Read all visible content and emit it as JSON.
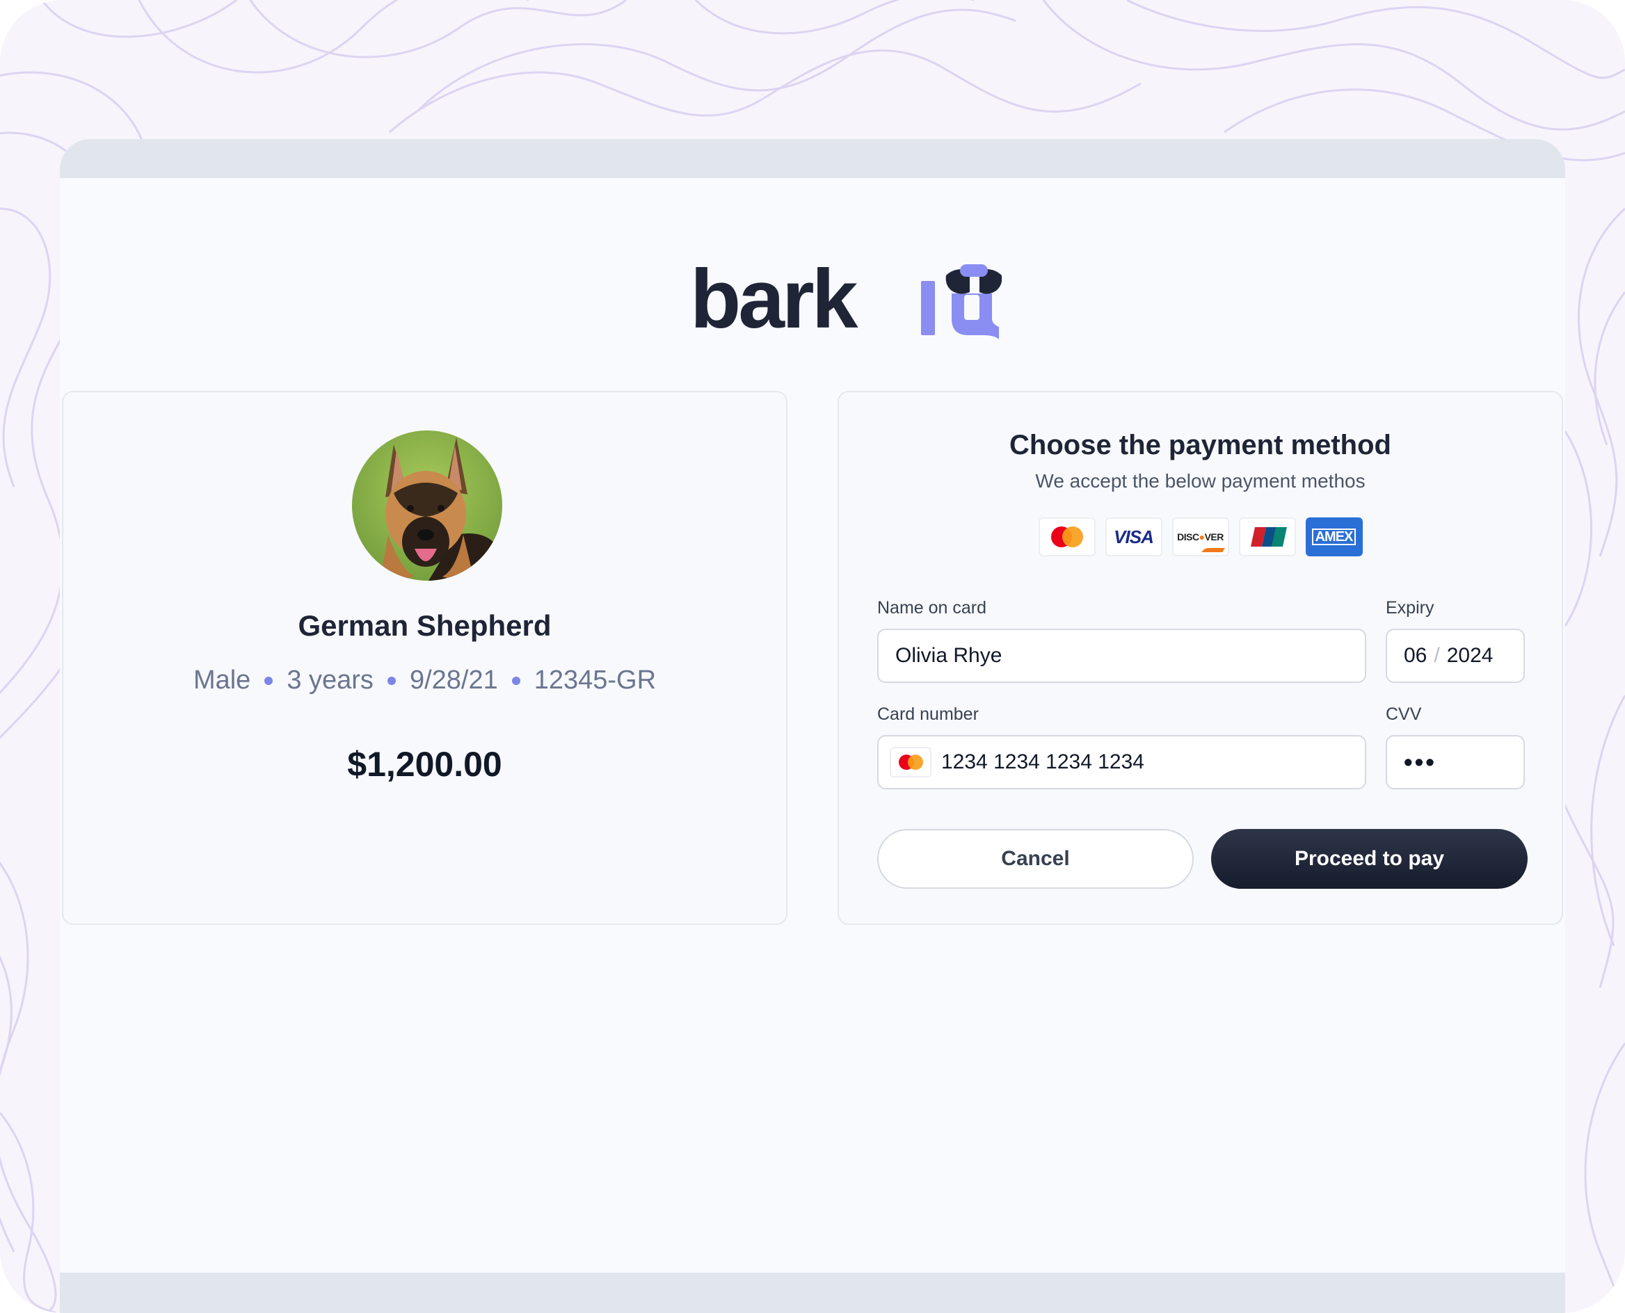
{
  "brand": {
    "logo_text": "bark",
    "logo_accent": "IQ",
    "accent_color": "#8a8ef2",
    "text_color": "#1f2537"
  },
  "pet": {
    "name": "German Shepherd",
    "sex": "Male",
    "age": "3 years",
    "date": "9/28/21",
    "id": "12345-GR",
    "price": "$1,200.00"
  },
  "payment": {
    "title": "Choose the payment method",
    "subtitle": "We accept the below payment methos",
    "accepted_cards": [
      "mastercard-icon",
      "visa-icon",
      "discover-icon",
      "unionpay-icon",
      "amex-icon"
    ],
    "visa_text": "VISA",
    "discover_text_a": "DISC",
    "discover_text_b": "VER",
    "amex_text": "AMEX",
    "name_label": "Name on card",
    "name_value": "Olivia Rhye",
    "expiry_label": "Expiry",
    "expiry_month": "06",
    "expiry_sep": "/",
    "expiry_year": "2024",
    "card_number_label": "Card number",
    "card_number_value": "1234 1234 1234 1234",
    "cvv_label": "CVV",
    "cvv_value": "•••",
    "cancel_label": "Cancel",
    "proceed_label": "Proceed to pay"
  }
}
